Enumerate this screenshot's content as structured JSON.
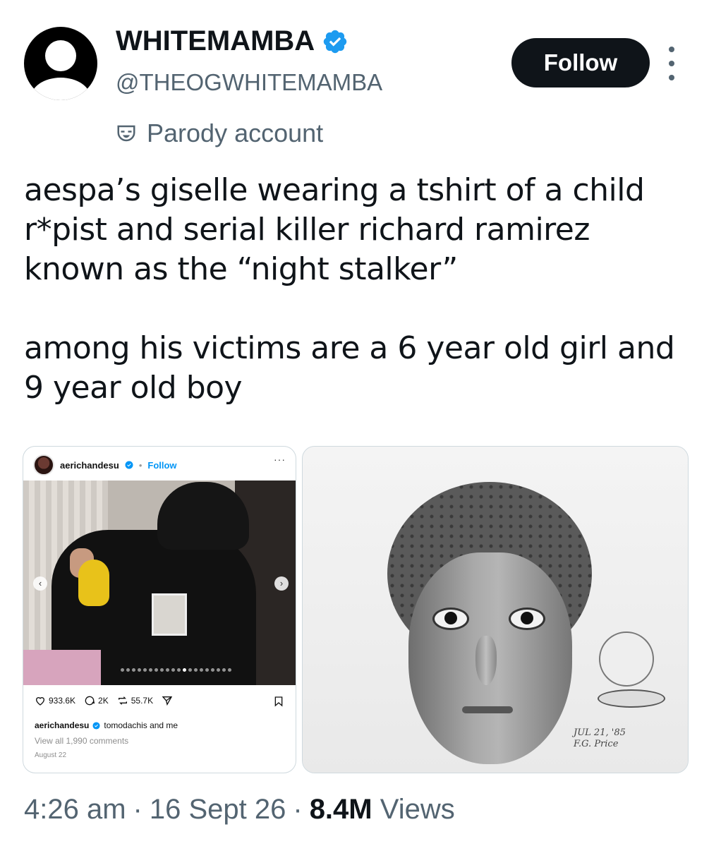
{
  "header": {
    "display_name": "WHITEMAMBA",
    "handle": "@THEOGWHITEMAMBA",
    "follow_label": "Follow",
    "parody_label": "Parody account"
  },
  "tweet": {
    "paragraph1": "aespa’s giselle wearing a tshirt of a child r*pist and serial killer richard ramirez known as the “night stalker”",
    "paragraph2": "among his victims are a 6 year old girl and 9 year old boy"
  },
  "instagram": {
    "username": "aerichandesu",
    "follow_label": "Follow",
    "likes": "933.6K",
    "comments": "2K",
    "reposts": "55.7K",
    "caption_user": "aerichandesu",
    "caption_text": "tomodachis and me",
    "view_comments": "View all 1,990 comments",
    "date": "August 22"
  },
  "sketch": {
    "note": "JUL 21, '85\nF.G. Price"
  },
  "footer": {
    "time": "4:26 am",
    "sep1": "·",
    "date": "16 Sept 26",
    "sep2": "·",
    "views_count": "8.4M",
    "views_label": "Views"
  },
  "colors": {
    "verified_blue": "#1d9bf0",
    "secondary_text": "#536471",
    "primary_text": "#0f1419",
    "ig_follow_blue": "#0095f6"
  }
}
